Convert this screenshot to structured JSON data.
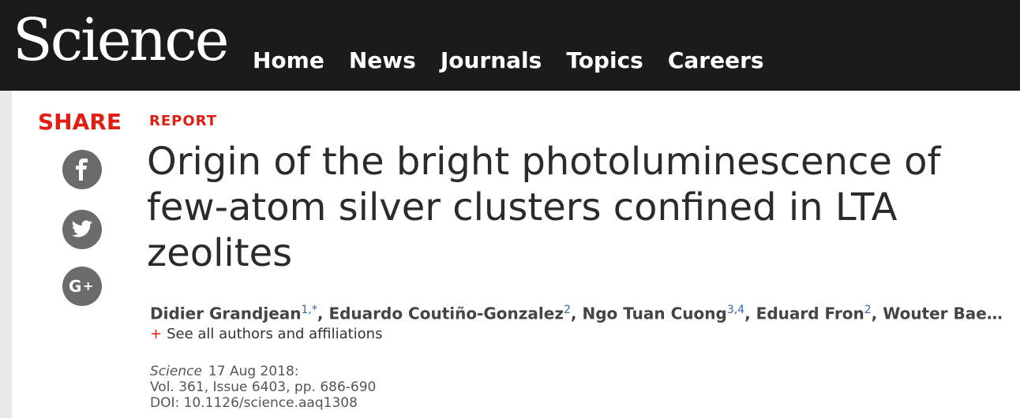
{
  "header": {
    "logo": "Science",
    "nav": [
      "Home",
      "News",
      "Journals",
      "Topics",
      "Careers"
    ]
  },
  "share": {
    "label": "SHARE",
    "buttons": [
      "facebook",
      "twitter",
      "google-plus"
    ]
  },
  "article": {
    "kicker": "REPORT",
    "title": "Origin of the bright photoluminescence of few-atom silver clusters confined in LTA zeolites",
    "authors": [
      {
        "name": "Didier Grandjean",
        "sup": "1,*"
      },
      {
        "name": "Eduardo Coutiño-Gonzalez",
        "sup": "2"
      },
      {
        "name": "Ngo Tuan Cuong",
        "sup": "3,4"
      },
      {
        "name": "Eduard Fron",
        "sup": "2"
      },
      {
        "name": "Wouter Bae…",
        "sup": ""
      }
    ],
    "see_all": "See all authors and affiliations",
    "see_all_prefix": "+",
    "citation": {
      "journal": "Science",
      "date": "17 Aug 2018:",
      "volume": "Vol. 361, Issue 6403, pp. 686-690",
      "doi": "DOI: 10.1126/science.aaq1308"
    }
  },
  "colors": {
    "accent": "#e21e13",
    "header_bg": "#1b1b1b",
    "social_bg": "#6b6b6b",
    "link_blue": "#2d6bb3"
  }
}
